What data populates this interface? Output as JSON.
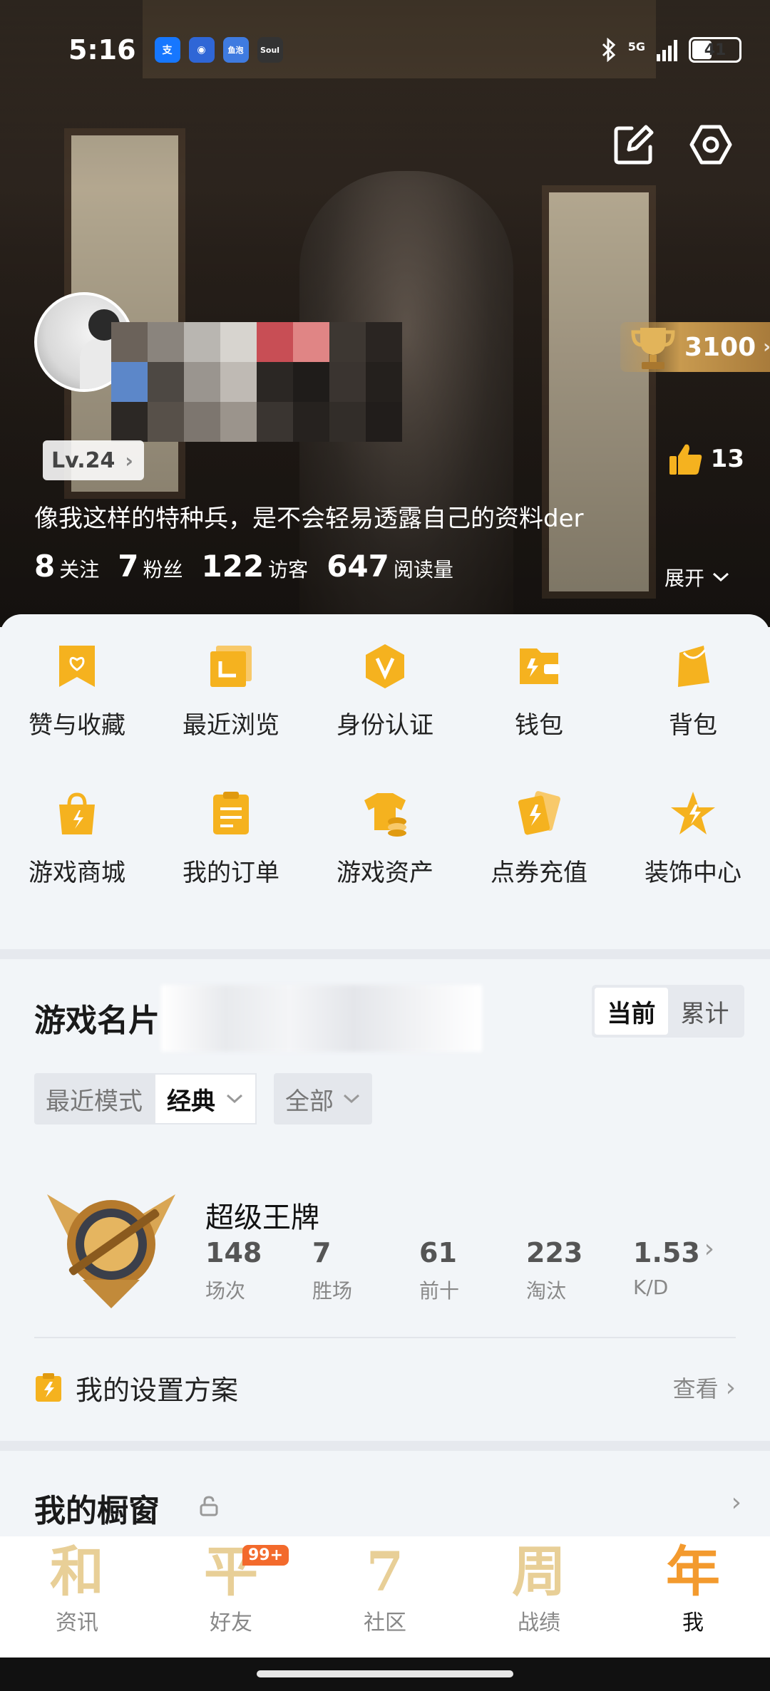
{
  "status": {
    "time": "5:16",
    "apps": [
      {
        "name": "alipay-icon",
        "text": "支",
        "color": "#1677ff"
      },
      {
        "name": "app-eye-icon",
        "text": "◉",
        "color": "#2f66d6"
      },
      {
        "name": "app-xianyu-icon",
        "text": "鱼泡",
        "color": "#3f7be0"
      },
      {
        "name": "soul-icon",
        "text": "Soul",
        "color": "#333333"
      }
    ],
    "network": "5G",
    "battery": "41"
  },
  "profile": {
    "trophy_score": "3100",
    "level": "Lv.24",
    "likes": "13",
    "bio": "像我这样的特种兵，是不会轻易透露自己的资料der",
    "stats": [
      {
        "value": "8",
        "label": "关注"
      },
      {
        "value": "7",
        "label": "粉丝"
      },
      {
        "value": "122",
        "label": "访客"
      },
      {
        "value": "647",
        "label": "阅读量"
      }
    ],
    "expand_label": "展开"
  },
  "shortcuts": [
    {
      "label": "赞与收藏",
      "icon": "favorite-bookmark-icon"
    },
    {
      "label": "最近浏览",
      "icon": "recent-browse-icon"
    },
    {
      "label": "身份认证",
      "icon": "verify-identity-icon"
    },
    {
      "label": "钱包",
      "icon": "wallet-icon"
    },
    {
      "label": "背包",
      "icon": "backpack-icon"
    },
    {
      "label": "游戏商城",
      "icon": "game-store-icon"
    },
    {
      "label": "我的订单",
      "icon": "orders-icon"
    },
    {
      "label": "游戏资产",
      "icon": "game-assets-icon"
    },
    {
      "label": "点券充值",
      "icon": "coupon-recharge-icon"
    },
    {
      "label": "装饰中心",
      "icon": "decoration-center-icon"
    }
  ],
  "game_card": {
    "title": "游戏名片",
    "toggle": [
      "当前",
      "累计"
    ],
    "mode_label": "最近模式",
    "mode_value": "经典",
    "scope_value": "全部",
    "rank_name": "超级王牌",
    "rank_stats": [
      {
        "value": "148",
        "label": "场次"
      },
      {
        "value": "7",
        "label": "胜场"
      },
      {
        "value": "61",
        "label": "前十"
      },
      {
        "value": "223",
        "label": "淘汰"
      },
      {
        "value": "1.53",
        "label": "K/D"
      }
    ],
    "plan_label": "我的设置方案",
    "plan_action": "查看"
  },
  "showcase": {
    "title": "我的橱窗"
  },
  "tabs": [
    {
      "glyph": "和",
      "label": "资讯",
      "active": false
    },
    {
      "glyph": "平",
      "label": "好友",
      "active": false,
      "badge": "99+"
    },
    {
      "glyph": "7",
      "label": "社区",
      "active": false
    },
    {
      "glyph": "周",
      "label": "战绩",
      "active": false
    },
    {
      "glyph": "年",
      "label": "我",
      "active": true
    }
  ],
  "colors": {
    "accent": "#f5b21f",
    "active_tab": "#f39a2e",
    "inactive_tab": "#e8cf97"
  }
}
